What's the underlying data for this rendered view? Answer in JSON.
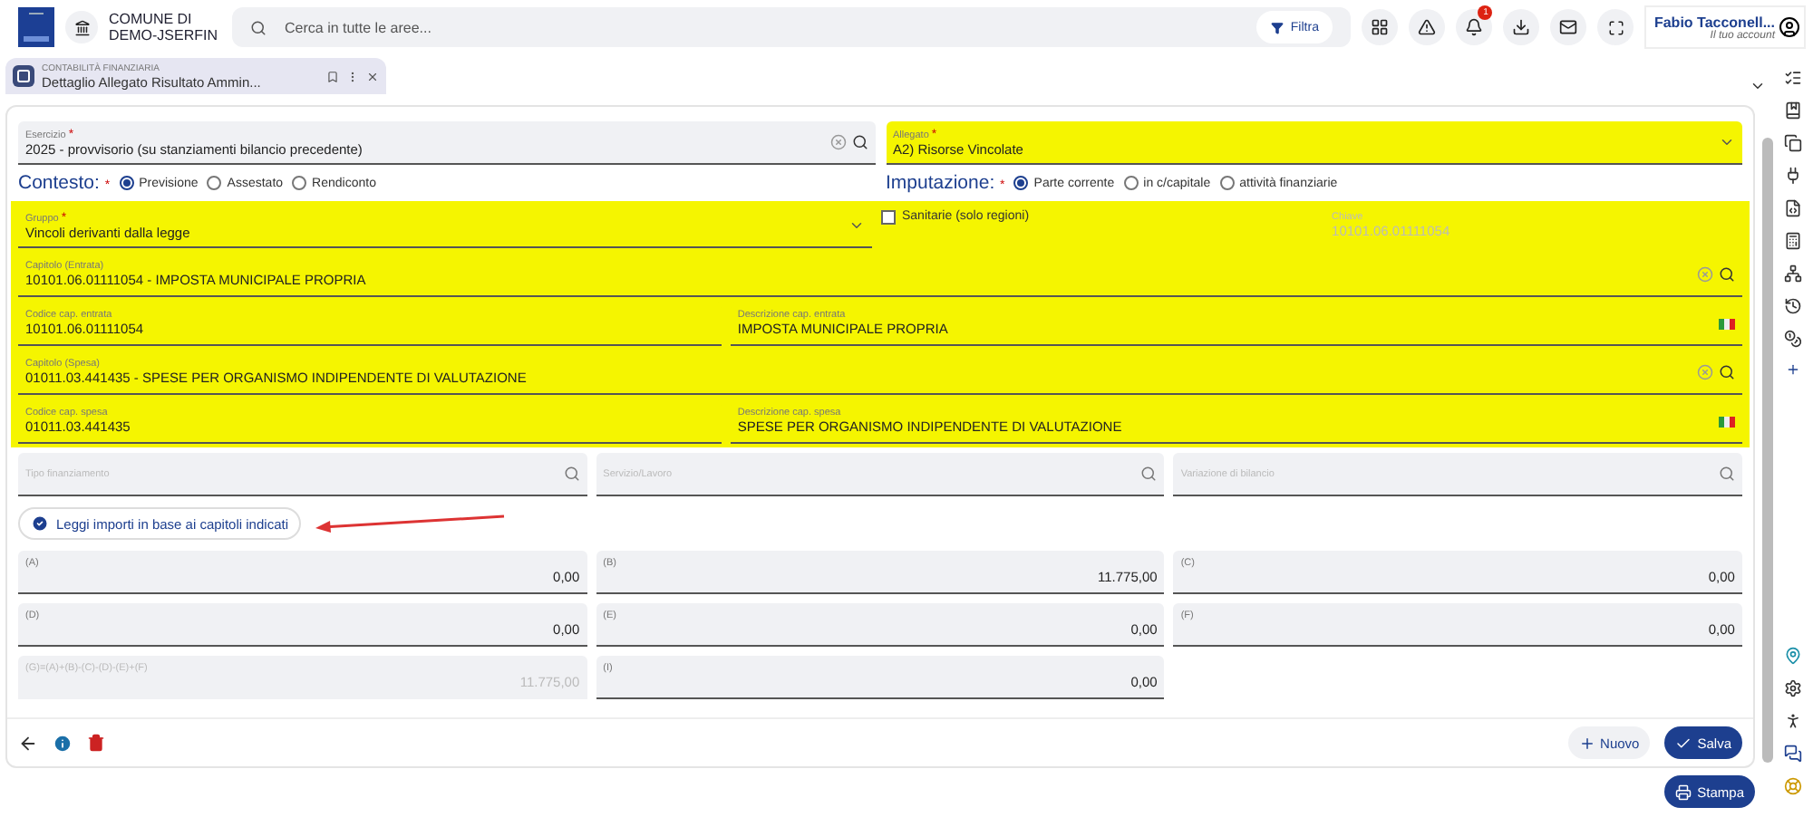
{
  "header": {
    "org": "COMUNE DI DEMO-JSERFIN",
    "search_placeholder": "Cerca in tutte le aree...",
    "filter": "Filtra",
    "notifications": "1",
    "user": {
      "name": "Fabio Tacconell...",
      "subtitle": "Il tuo account"
    }
  },
  "tab": {
    "module": "CONTABILITÀ FINANZIARIA",
    "title": "Dettaglio Allegato Risultato Ammin...",
    "selected": true
  },
  "top_fields": [
    {
      "kind": "lookup",
      "label": "Esercizio",
      "required_mark": "*",
      "value": "2025 - provvisorio (su stanziamenti bilancio precedente)",
      "highlighted": false
    },
    {
      "kind": "select",
      "label": "Allegato",
      "required_mark": "*",
      "value": "A2) Risorse Vincolate",
      "highlighted": true
    }
  ],
  "radio_groups": [
    {
      "label": "Contesto:",
      "required_mark": "*",
      "options": [
        {
          "label": "Previsione",
          "selected": true
        },
        {
          "label": "Assestato",
          "selected": false
        },
        {
          "label": "Rendiconto",
          "selected": false
        }
      ]
    },
    {
      "label": "Imputazione:",
      "required_mark": "*",
      "options": [
        {
          "label": "Parte corrente",
          "selected": true
        },
        {
          "label": "in c/capitale",
          "selected": false
        },
        {
          "label": "attività finanziarie",
          "selected": false
        }
      ]
    }
  ],
  "vincoli": {
    "highlighted": true,
    "rows": [
      [
        {
          "kind": "select",
          "label": "Gruppo",
          "required_mark": "*",
          "value": "Vincoli derivanti dalla legge",
          "highlighted": true
        },
        {
          "kind": "checkbox",
          "label": "Sanitarie (solo regioni)",
          "checked": false
        },
        {
          "kind": "text",
          "label": "Chiave",
          "value": "10101.06.01111054",
          "disabled": true,
          "highlighted": true
        }
      ],
      [
        {
          "kind": "lookup",
          "label": "Capitolo (Entrata)",
          "value": "10101.06.01111054 - IMPOSTA MUNICIPALE PROPRIA",
          "highlighted": true
        }
      ],
      [
        {
          "kind": "text",
          "label": "Codice cap. entrata",
          "value": "10101.06.01111054",
          "highlighted": true
        },
        {
          "kind": "translatable",
          "label": "Descrizione cap. entrata",
          "value": "IMPOSTA MUNICIPALE PROPRIA",
          "highlighted": true
        }
      ],
      [
        {
          "kind": "lookup",
          "label": "Capitolo (Spesa)",
          "value": "01011.03.441435 - SPESE PER ORGANISMO INDIPENDENTE DI VALUTAZIONE",
          "highlighted": true
        }
      ],
      [
        {
          "kind": "text",
          "label": "Codice cap. spesa",
          "value": "01011.03.441435",
          "highlighted": true
        },
        {
          "kind": "translatable",
          "label": "Descrizione cap. spesa",
          "value": "SPESE PER ORGANISMO INDIPENDENTE DI VALUTAZIONE",
          "highlighted": true
        }
      ]
    ]
  },
  "filters": [
    {
      "kind": "search",
      "placeholder": "Tipo finanziamento"
    },
    {
      "kind": "search",
      "placeholder": "Servizio/Lavoro"
    },
    {
      "kind": "search",
      "placeholder": "Variazione di bilancio"
    }
  ],
  "read_button": "Leggi importi in base ai capitoli indicati",
  "amounts": [
    [
      {
        "label": "(A)",
        "value": "0,00"
      },
      {
        "label": "(B)",
        "value": "11.775,00"
      },
      {
        "label": "(C)",
        "value": "0,00"
      }
    ],
    [
      {
        "label": "(D)",
        "value": "0,00"
      },
      {
        "label": "(E)",
        "value": "0,00"
      },
      {
        "label": "(F)",
        "value": "0,00"
      }
    ],
    [
      {
        "label": "(G)=(A)+(B)-(C)-(D)-(E)+(F)",
        "value": "11.775,00",
        "disabled": true
      },
      {
        "label": "(I)",
        "value": "0,00"
      }
    ]
  ],
  "actions": {
    "new": "Nuovo",
    "save": "Salva"
  },
  "print": "Stampa"
}
